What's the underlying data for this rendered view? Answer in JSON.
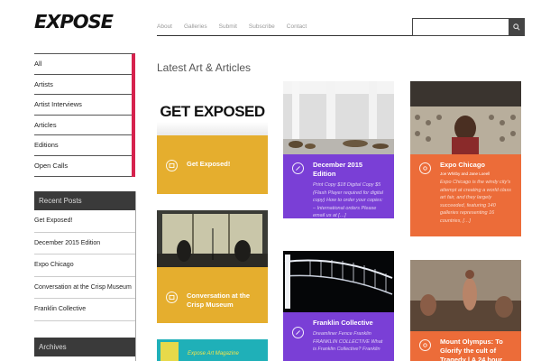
{
  "logo": "EXPOSE",
  "nav": [
    "About",
    "Galleries",
    "Submit",
    "Subscribe",
    "Contact"
  ],
  "search": {
    "placeholder": ""
  },
  "categories": [
    "All",
    "Artists",
    "Artist Interviews",
    "Articles",
    "Editions",
    "Open Calls"
  ],
  "recent_posts": {
    "title": "Recent Posts",
    "items": [
      "Get Exposed!",
      "December 2015 Edition",
      "Expo Chicago",
      "Conversation at the Crisp Museum",
      "Franklin Collective"
    ]
  },
  "archives": {
    "title": "Archives"
  },
  "main": {
    "title": "Latest Art & Articles"
  },
  "cards": [
    {
      "title": "Get Exposed!",
      "banner": "GET EXPOSED",
      "color": "#e5ae2e"
    },
    {
      "title": "December 2015 Edition",
      "excerpt": "Print Copy $18 Digital Copy $5 (Flash Player required for digital copy) How to order your copies: – International orders Please email us at […]",
      "color": "#7a3fd6"
    },
    {
      "title": "Expo Chicago",
      "byline": "Joe Whitby and Jane Loeell",
      "excerpt": "Expo Chicago is the windy city's attempt at creating a world class art fair, and they largely succeeded, featuring 140 galleries representing 16 countries, […]",
      "color": "#ec6c39"
    },
    {
      "title": "Conversation at the Crisp Museum",
      "color": "#e5ae2e"
    },
    {
      "title": "Franklin Collective",
      "excerpt": "Dreamliner Fence Franklin FRANKLIN COLLECTIVE What is Franklin Collective? Franklin",
      "color": "#7a3fd6"
    },
    {
      "title": "Mount Olympus: To Glorify the cult of Tragedy | A 24 hour",
      "color": "#ec6c39"
    },
    {
      "banner": "Expose Art Magazine",
      "color": "#1fb0b8"
    }
  ],
  "colors": {
    "accent": "#d6224d",
    "dark": "#3a3a3a"
  }
}
